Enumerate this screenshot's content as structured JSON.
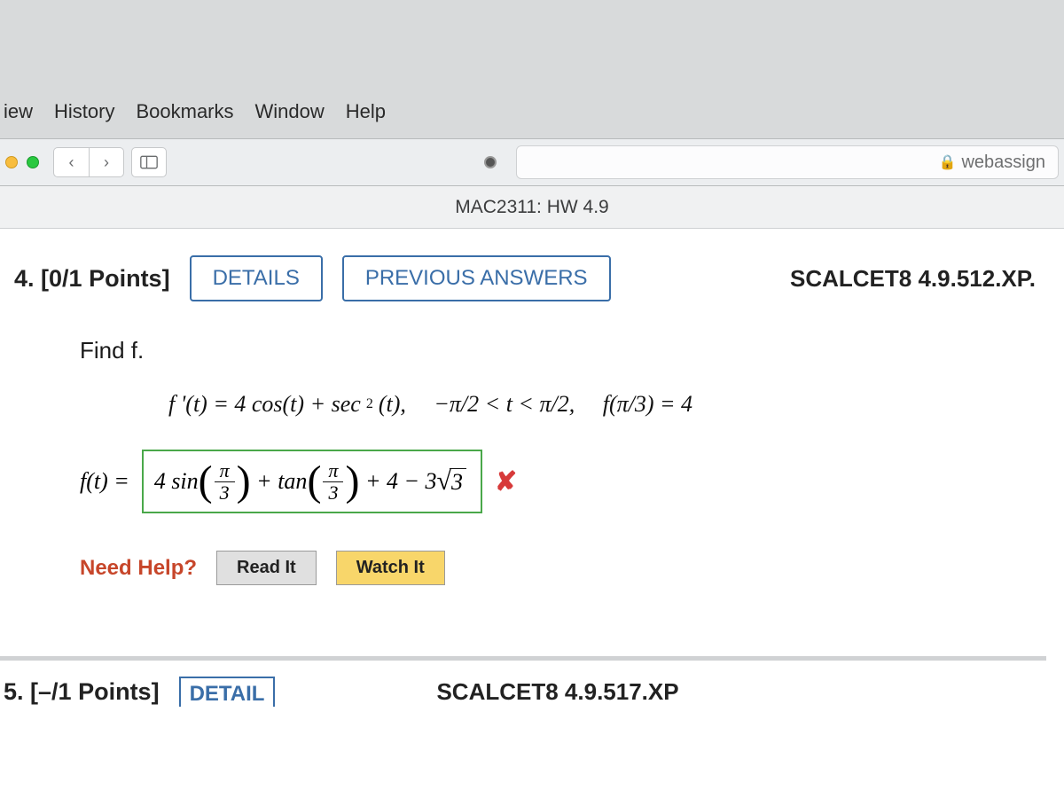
{
  "mac_menu": {
    "items": [
      "iew",
      "History",
      "Bookmarks",
      "Window",
      "Help"
    ]
  },
  "browser": {
    "site_label": "webassign",
    "tab_title": "MAC2311: HW 4.9"
  },
  "question4": {
    "header_num": "4.",
    "points": "[0/1 Points]",
    "details_btn": "DETAILS",
    "prev_answers_btn": "PREVIOUS ANSWERS",
    "source_ref": "SCALCET8 4.9.512.XP.",
    "prompt": "Find f.",
    "eq_prefix": "f '(t) = 4 cos(t) + sec",
    "eq_exp": "2",
    "eq_mid": "(t),",
    "eq_domain": "−π/2 < t < π/2,",
    "eq_cond": "f(π/3) = 4",
    "answer_label": "f(t) =",
    "answer_expr": {
      "coef1": "4 sin",
      "frac1_num": "π",
      "frac1_den": "3",
      "plus1": "+ tan",
      "frac2_num": "π",
      "frac2_den": "3",
      "tail_a": "+ 4 − 3",
      "sqrt_arg": "3"
    },
    "help_label": "Need Help?",
    "help_read": "Read It",
    "help_watch": "Watch It"
  },
  "question5": {
    "header_num": "5.",
    "points": "[–/1 Points]",
    "details_partial": "DETAIL",
    "source_ref": "SCALCET8 4.9.517.XP"
  }
}
